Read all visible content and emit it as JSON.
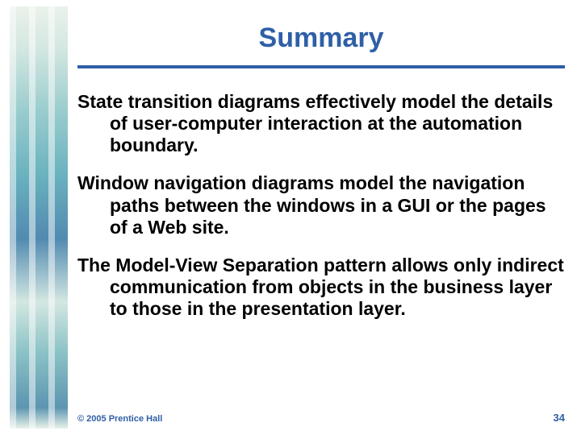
{
  "slide": {
    "title": "Summary",
    "paragraphs": [
      "State transition diagrams effectively model the details of user-computer interaction at the automation boundary.",
      "Window navigation diagrams model the navigation paths between the windows in a GUI or the pages of a Web site.",
      "The Model-View Separation pattern allows only indirect communication from objects in the business layer to those in the presentation layer."
    ],
    "copyright": "© 2005  Prentice Hall",
    "page_number": "34"
  }
}
